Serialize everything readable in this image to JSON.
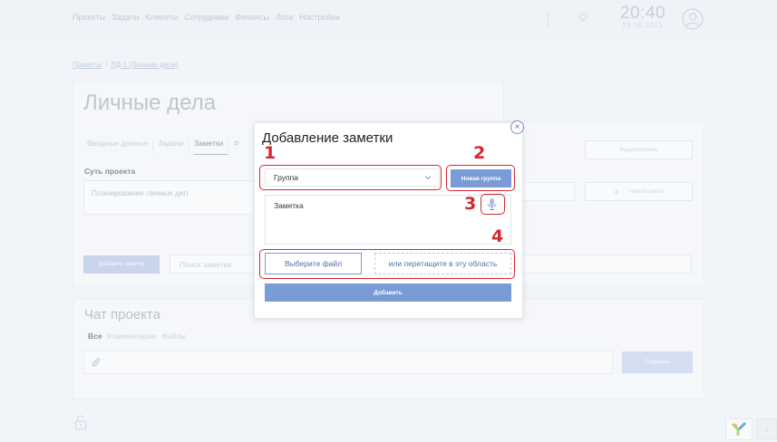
{
  "nav": {
    "items": [
      "Проекты",
      "Задачи",
      "Клиенты",
      "Сотрудники",
      "Финансы",
      "Логи",
      "Настройки"
    ]
  },
  "header": {
    "time": "20:40",
    "date": "29.06.2021",
    "icons": [
      "lightbulb-icon",
      "user-avatar-icon"
    ]
  },
  "breadcrumb": {
    "root": "Проекты",
    "separator": "/",
    "current": "ЛД-1 (Личные дела)"
  },
  "project": {
    "title": "Личные дела",
    "tabs": [
      "Вводные данные",
      "Задачи",
      "Заметки",
      "Ф"
    ],
    "active_tab": "Заметки",
    "section_label": "Суть проекта",
    "description": "Планирование личных дел",
    "edit_label": "Редактировать",
    "new_client_label": "Новый клиент",
    "add_note_label": "Добавить заметку",
    "search_notes_placeholder": "Поиск заметки"
  },
  "chat": {
    "title": "Чат проекта",
    "tabs": [
      "Все",
      "Комментарии",
      "Файлы"
    ],
    "send_label": "Отправить"
  },
  "modal": {
    "title": "Добавление заметки",
    "close_glyph": "×",
    "group_value": "Группа",
    "new_group_label": "Новая группа",
    "note_placeholder": "Заметка",
    "choose_file_label": "Выберите файл",
    "dropzone_label": "или перетащите в эту область",
    "submit_label": "Добавить"
  },
  "annotations": [
    "1",
    "2",
    "3",
    "4"
  ],
  "footer": {
    "collapse_glyph": "‹"
  },
  "colors": {
    "accent": "#7a9bd6",
    "annotation": "#d4282f",
    "background": "#f4f6fa"
  }
}
